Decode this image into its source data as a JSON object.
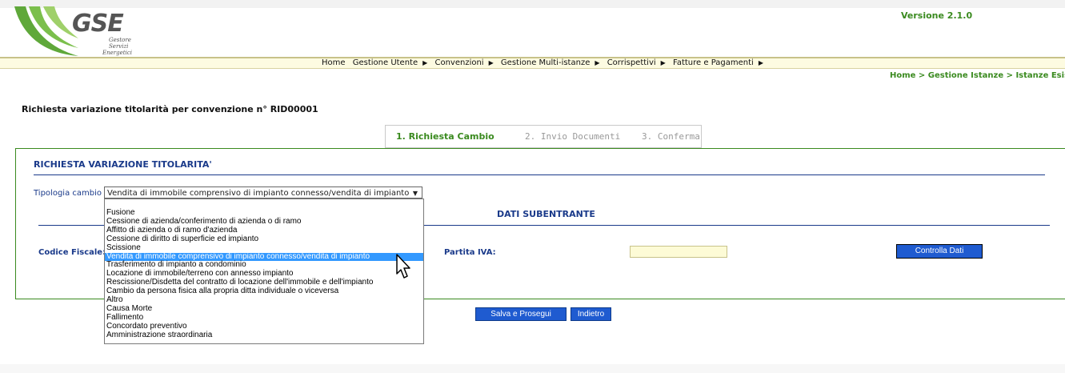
{
  "header": {
    "logo_text": "GSE",
    "logo_sub": [
      "Gestore",
      "Servizi",
      "Energetici"
    ],
    "version": "Versione 2.1.0"
  },
  "menu": {
    "items": [
      "Home",
      "Gestione Utente",
      "Convenzioni",
      "Gestione Multi-istanze",
      "Corrispettivi",
      "Fatture e Pagamenti"
    ]
  },
  "breadcrumb": "Home > Gestione Istanze > Istanze Esistenti",
  "page_title_prefix": "Richiesta variazione titolarità per convenzione n°",
  "convention_id": "RID00001",
  "steps": [
    "1. Richiesta Cambio",
    "2. Invio Documenti",
    "3. Conferma"
  ],
  "form": {
    "section_title": "RICHIESTA VARIAZIONE TITOLARITA'",
    "tipologia_label": "Tipologia cambio",
    "tipologia_value": "Vendita di immobile comprensivo di impianto connesso/vendita di impianto",
    "dati_title": "DATI SUBENTRANTE",
    "codice_fiscale_label": "Codice Fiscale:",
    "partita_iva_label": "Partita IVA:",
    "partita_iva_value": "",
    "controlla_label": "Controlla Dati"
  },
  "dropdown_options": [
    "Fusione",
    "Cessione di azienda/conferimento di azienda o di ramo",
    "Affitto di azienda o di ramo d'azienda",
    "Cessione di diritto di superficie ed impianto",
    "Scissione",
    "Vendita di immobile comprensivo di impianto connesso/vendita di impianto",
    "Trasferimento di impianto a condominio",
    "Locazione di immobile/terreno con annesso impianto",
    "Rescissione/Disdetta del contratto di locazione dell'immobile e dell'impianto",
    "Cambio da persona fisica alla propria ditta individuale o viceversa",
    "Altro",
    "Causa Morte",
    "Fallimento",
    "Concordato preventivo",
    "Amministrazione straordinaria"
  ],
  "selected_index": 5,
  "actions": {
    "salva_label": "Salva e Prosegui",
    "indietro_label": "Indietro"
  },
  "colors": {
    "brand_green": "#3a8a1f",
    "label_blue": "#1a3a8a",
    "button_blue": "#1f5bd0",
    "highlight": "#3399ff"
  }
}
